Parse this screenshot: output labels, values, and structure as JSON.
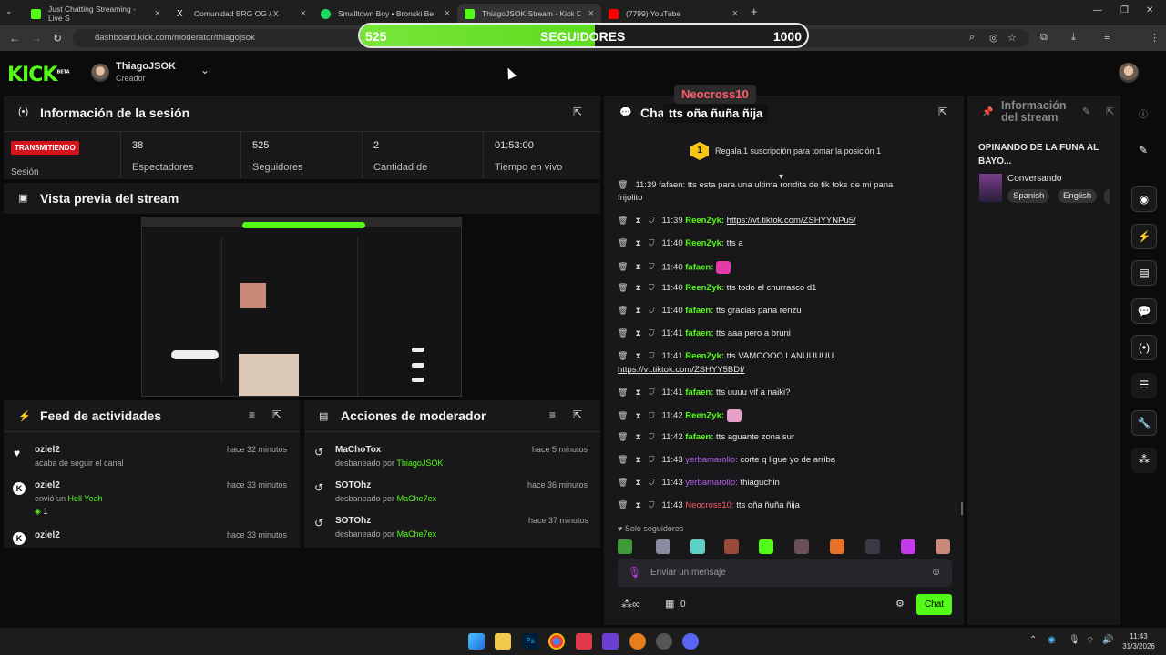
{
  "browser": {
    "tabs": [
      {
        "label": "Just Chatting Streaming - Live S",
        "icon": "kick-icon",
        "color": "#53fc18"
      },
      {
        "label": "Comunidad BRG OG / X",
        "icon": "x-icon",
        "color": "#ffffff"
      },
      {
        "label": "Smalltown Boy • Bronski Be",
        "icon": "spotify-icon",
        "color": "#1ed760"
      },
      {
        "label": "ThiagoJSOK Stream - Kick Dash",
        "icon": "kick-icon",
        "color": "#53fc18"
      },
      {
        "label": "(7799) YouTube",
        "icon": "youtube-icon",
        "color": "#ff0000"
      }
    ],
    "url": "dashboard.kick.com/moderator/thiagojsok"
  },
  "goal": {
    "current": "525",
    "label": "SEGUIDORES",
    "target": "1000",
    "progress": 0.525
  },
  "header": {
    "logo": "KICK",
    "logo_badge": "BETA",
    "user_name": "ThiagoJSOK",
    "user_role": "Creador"
  },
  "session": {
    "title": "Información de la sesión",
    "badge": "TRANSMITIENDO",
    "badge_label": "Sesión",
    "stats": [
      {
        "value": "38",
        "label": "Espectadores"
      },
      {
        "value": "525",
        "label": "Seguidores"
      },
      {
        "value": "2",
        "label": "Cantidad de"
      },
      {
        "value": "01:53:00",
        "label": "Tiempo en vivo"
      }
    ]
  },
  "preview": {
    "title": "Vista previa del stream"
  },
  "feed": {
    "title": "Feed de actividades",
    "items": [
      {
        "user": "oziel2",
        "time": "hace 32 minutos",
        "text": "acaba de seguir el canal"
      },
      {
        "user": "oziel2",
        "time": "hace 33 minutos",
        "text": "envió un",
        "highlight": "Hell Yeah",
        "count": "1"
      },
      {
        "user": "oziel2",
        "time": "hace 33 minutos",
        "text": ""
      }
    ]
  },
  "modactions": {
    "title": "Acciones de moderador",
    "items": [
      {
        "user": "MaChoTox",
        "time": "hace 5 minutos",
        "text": "desbaneado por",
        "by": "ThiagoJSOK"
      },
      {
        "user": "SOTOhz",
        "time": "hace 36 minutos",
        "text": "desbaneado por",
        "by": "MaChe7ex"
      },
      {
        "user": "SOTOhz",
        "time": "hace 37 minutos",
        "text": "desbaneado por",
        "by": "MaChe7ex"
      }
    ]
  },
  "tts_overlay": {
    "user": "Neocross10",
    "message": "tts oña ñuña ñija"
  },
  "chat": {
    "title": "Chat",
    "pinned": {
      "rank": "1",
      "text": "Regala 1 suscripción para tomar la posición 1"
    },
    "top_partial": "11:39 fafaen: tts esta para una ultima rondita de tik toks de mi pana",
    "top_partial2": "frijolito",
    "messages": [
      {
        "time": "11:39",
        "user": "ReenZyk:",
        "text": "https://vt.tiktok.com/ZSHYYNPu5/",
        "color": "g",
        "link": true
      },
      {
        "time": "11:40",
        "user": "ReenZyk:",
        "text": "tts a",
        "color": "g"
      },
      {
        "time": "11:40",
        "user": "fafaen:",
        "text": "",
        "color": "g",
        "emote": "heart-emote"
      },
      {
        "time": "11:40",
        "user": "ReenZyk:",
        "text": "tts todo el churrasco d1",
        "color": "g"
      },
      {
        "time": "11:40",
        "user": "fafaen:",
        "text": "tts gracias pana renzu",
        "color": "g"
      },
      {
        "time": "11:41",
        "user": "fafaen:",
        "text": "tts aaa pero a bruni",
        "color": "g"
      },
      {
        "time": "11:41",
        "user": "ReenZyk:",
        "text": "tts VAMOOOO LANUUUUU",
        "color": "g",
        "cont": "https://vt.tiktok.com/ZSHYY5BDf/"
      },
      {
        "time": "11:41",
        "user": "fafaen:",
        "text": "tts uuuu vif a naiki?",
        "color": "g"
      },
      {
        "time": "11:42",
        "user": "ReenZyk:",
        "text": "",
        "color": "g",
        "emote": "thunder-emote"
      },
      {
        "time": "11:42",
        "user": "fafaen:",
        "text": "tts aguante zona sur",
        "color": "g"
      },
      {
        "time": "11:43",
        "user": "yerbamarolio:",
        "text": "corte q ligue yo de arriba",
        "color": "p"
      },
      {
        "time": "11:43",
        "user": "yerbamarolio:",
        "text": "thiaguchin",
        "color": "p"
      },
      {
        "time": "11:43",
        "user": "Neocross10:",
        "text": "tts oña ñuña ñija",
        "color": "r"
      }
    ],
    "followers_only": "Solo seguidores",
    "input_placeholder": "Enviar un mensaje",
    "points": "0",
    "send_label": "Chat"
  },
  "stream_info": {
    "title": "Información del stream",
    "stream_title": "OPINANDO DE LA FUNA AL BAYO...",
    "category": "Conversando",
    "tags": [
      "Spanish",
      "English"
    ]
  },
  "taskbar": {
    "time": "11:43",
    "date": "31/3/2026"
  }
}
